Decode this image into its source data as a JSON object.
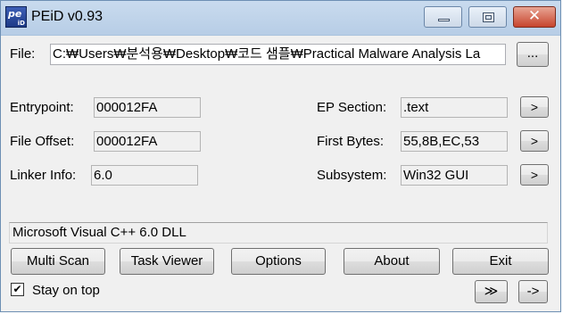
{
  "window": {
    "title": "PEiD v0.93"
  },
  "file": {
    "label": "File:",
    "path": "C:₩Users₩분석용₩Desktop₩코드 샘플₩Practical Malware Analysis La",
    "browse_label": "..."
  },
  "left_fields": [
    {
      "label": "Entrypoint:",
      "value": "000012FA"
    },
    {
      "label": "File Offset:",
      "value": "000012FA"
    },
    {
      "label": "Linker Info:",
      "value": "6.0"
    }
  ],
  "right_fields": [
    {
      "label": "EP Section:",
      "value": ".text",
      "button": ">"
    },
    {
      "label": "First Bytes:",
      "value": "55,8B,EC,53",
      "button": ">"
    },
    {
      "label": "Subsystem:",
      "value": "Win32 GUI",
      "button": ">"
    }
  ],
  "result": "Microsoft Visual C++ 6.0 DLL",
  "buttons": {
    "multi_scan": "Multi Scan",
    "task_viewer": "Task Viewer",
    "options": "Options",
    "about": "About",
    "exit": "Exit"
  },
  "stay_on_top": {
    "label": "Stay on top",
    "checked": true,
    "mark": "✔"
  },
  "bottom_buttons": {
    "extra": "≫",
    "plugins": "->"
  }
}
